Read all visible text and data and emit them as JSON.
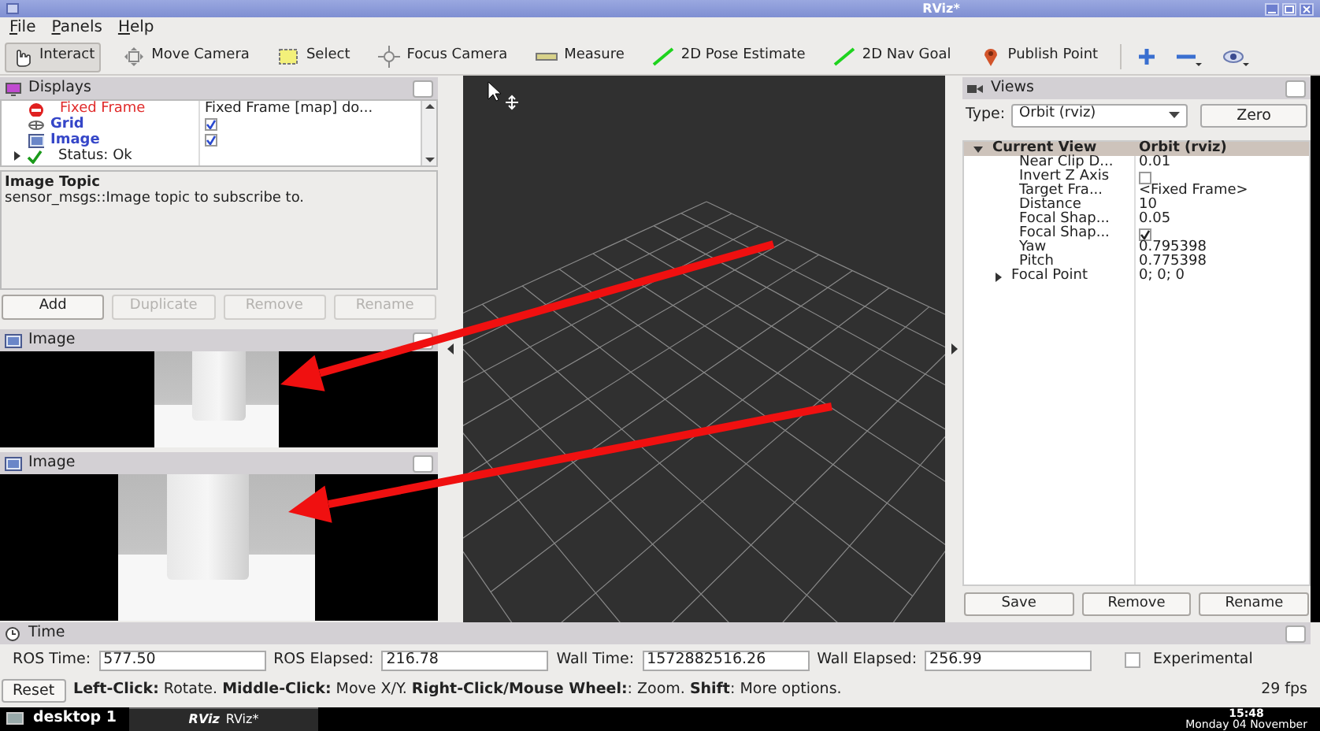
{
  "window": {
    "title": "RViz*"
  },
  "menu": [
    "File",
    "Panels",
    "Help"
  ],
  "toolbar": [
    {
      "label": "Interact",
      "kind": "interact",
      "selected": true
    },
    {
      "label": "Move Camera",
      "kind": "move_camera",
      "selected": false
    },
    {
      "label": "Select",
      "kind": "select",
      "selected": false
    },
    {
      "label": "Focus Camera",
      "kind": "focus_camera",
      "selected": false
    },
    {
      "label": "Measure",
      "kind": "measure",
      "selected": false
    },
    {
      "label": "2D Pose Estimate",
      "kind": "pose_estimate",
      "selected": false
    },
    {
      "label": "2D Nav Goal",
      "kind": "nav_goal",
      "selected": false
    },
    {
      "label": "Publish Point",
      "kind": "publish_point",
      "selected": false
    }
  ],
  "displays": {
    "title": "Displays",
    "items": [
      {
        "label": "Fixed Frame",
        "kind": "error",
        "value": "Fixed Frame [map] do..."
      },
      {
        "label": "Grid",
        "kind": "grid",
        "checked": true
      },
      {
        "label": "Image",
        "kind": "image",
        "checked": true
      },
      {
        "label": "Status: Ok",
        "kind": "status",
        "expanded": false
      }
    ]
  },
  "description": {
    "title": "Image Topic",
    "text": "sensor_msgs::Image topic to subscribe to."
  },
  "display_buttons": [
    {
      "label": "Add",
      "disabled": false
    },
    {
      "label": "Duplicate",
      "disabled": true
    },
    {
      "label": "Remove",
      "disabled": true
    },
    {
      "label": "Rename",
      "disabled": true
    }
  ],
  "image_panels": [
    {
      "title": "Image"
    },
    {
      "title": "Image"
    }
  ],
  "views": {
    "title": "Views",
    "type_label": "Type:",
    "type_value": "Orbit (rviz)",
    "zero_button": "Zero",
    "header": {
      "label": "Current View",
      "value": "Orbit (rviz)",
      "expanded": true
    },
    "properties": [
      {
        "label": "Near Clip D...",
        "kind": "text",
        "value": "0.01"
      },
      {
        "label": "Invert Z Axis",
        "kind": "checkbox",
        "checked": false
      },
      {
        "label": "Target Fra...",
        "kind": "text",
        "value": "<Fixed Frame>"
      },
      {
        "label": "Distance",
        "kind": "text",
        "value": "10"
      },
      {
        "label": "Focal Shap...",
        "kind": "text",
        "value": "0.05"
      },
      {
        "label": "Focal Shap...",
        "kind": "checkbox",
        "checked": true
      },
      {
        "label": "Yaw",
        "kind": "text",
        "value": "0.795398"
      },
      {
        "label": "Pitch",
        "kind": "text",
        "value": "0.775398"
      },
      {
        "label": "Focal Point",
        "kind": "group",
        "value": "0; 0; 0",
        "expanded": false
      }
    ],
    "buttons": [
      "Save",
      "Remove",
      "Rename"
    ]
  },
  "time": {
    "title": "Time",
    "fields": [
      {
        "label": "ROS Time:",
        "value": "577.50"
      },
      {
        "label": "ROS Elapsed:",
        "value": "216.78"
      },
      {
        "label": "Wall Time:",
        "value": "1572882516.26"
      },
      {
        "label": "Wall Elapsed:",
        "value": "256.99"
      }
    ],
    "experimental": {
      "label": "Experimental",
      "checked": false
    }
  },
  "status_bar": {
    "reset_button": "Reset",
    "help": "**Left-Click:** Rotate. **Middle-Click:** Move X/Y. **Right-Click/Mouse Wheel:**: Zoom. **Shift**: More options.",
    "fps": "29 fps"
  },
  "taskbar": {
    "workspace": "desktop 1",
    "tasks": [
      {
        "logo": "RViz",
        "label": "RViz*",
        "selected": true
      }
    ],
    "clock": "15:48",
    "date": "Monday 04 November"
  }
}
